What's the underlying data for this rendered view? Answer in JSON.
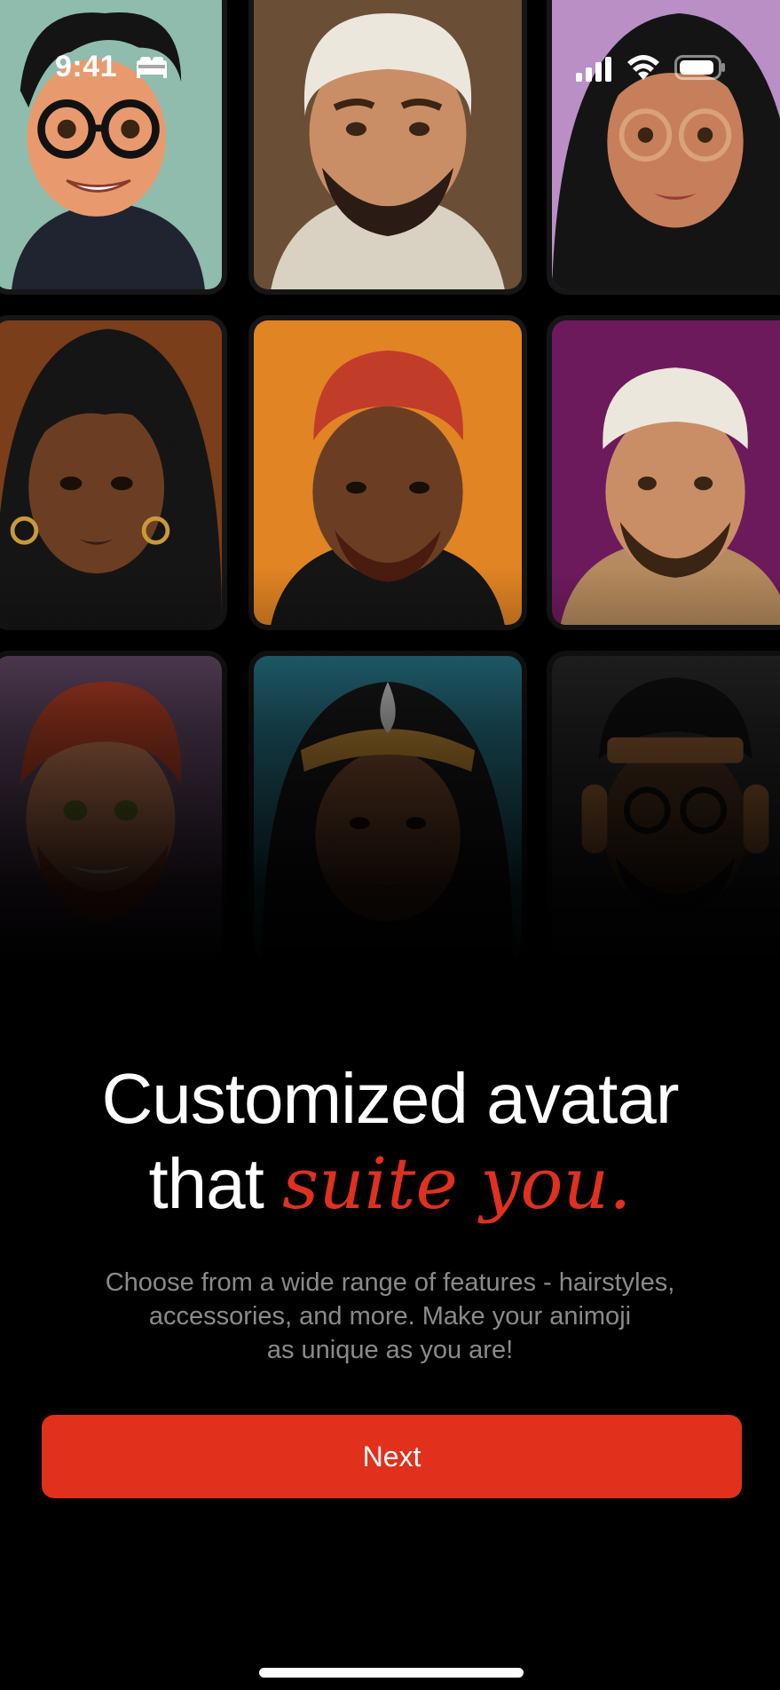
{
  "status_bar": {
    "time": "9:41",
    "icons": [
      "bed-icon",
      "cellular-signal-icon",
      "wifi-icon",
      "battery-icon"
    ]
  },
  "avatars": [
    {
      "name": "avatar-glasses-man",
      "background": "#8fbcac"
    },
    {
      "name": "avatar-white-turban-man",
      "background": "#6b4e36"
    },
    {
      "name": "avatar-curly-hair-woman-glasses",
      "background": "#b98fc6"
    },
    {
      "name": "avatar-braided-hair-woman",
      "background": "#7a3e1a"
    },
    {
      "name": "avatar-red-hair-man-hoodie",
      "background": "#e08424"
    },
    {
      "name": "avatar-kufi-cap-man",
      "background": "#6d1a5c"
    },
    {
      "name": "avatar-ginger-bearded-man",
      "background": "#6b4e6e"
    },
    {
      "name": "avatar-headband-woman",
      "background": "#2a7c90"
    },
    {
      "name": "avatar-headphones-man",
      "background": "#2a2a2a"
    }
  ],
  "headline": {
    "line1": "Customized avatar",
    "line2_plain": "that ",
    "line2_accent": "suite you."
  },
  "description": {
    "line1": "Choose from a wide range of features - hairstyles,",
    "line2": "accessories, and more. Make your animoji",
    "line3": "as unique as you are!"
  },
  "next_button": {
    "label": "Next"
  },
  "colors": {
    "background": "#000000",
    "accent": "#e1301c",
    "body_text": "#8a8a8a"
  }
}
